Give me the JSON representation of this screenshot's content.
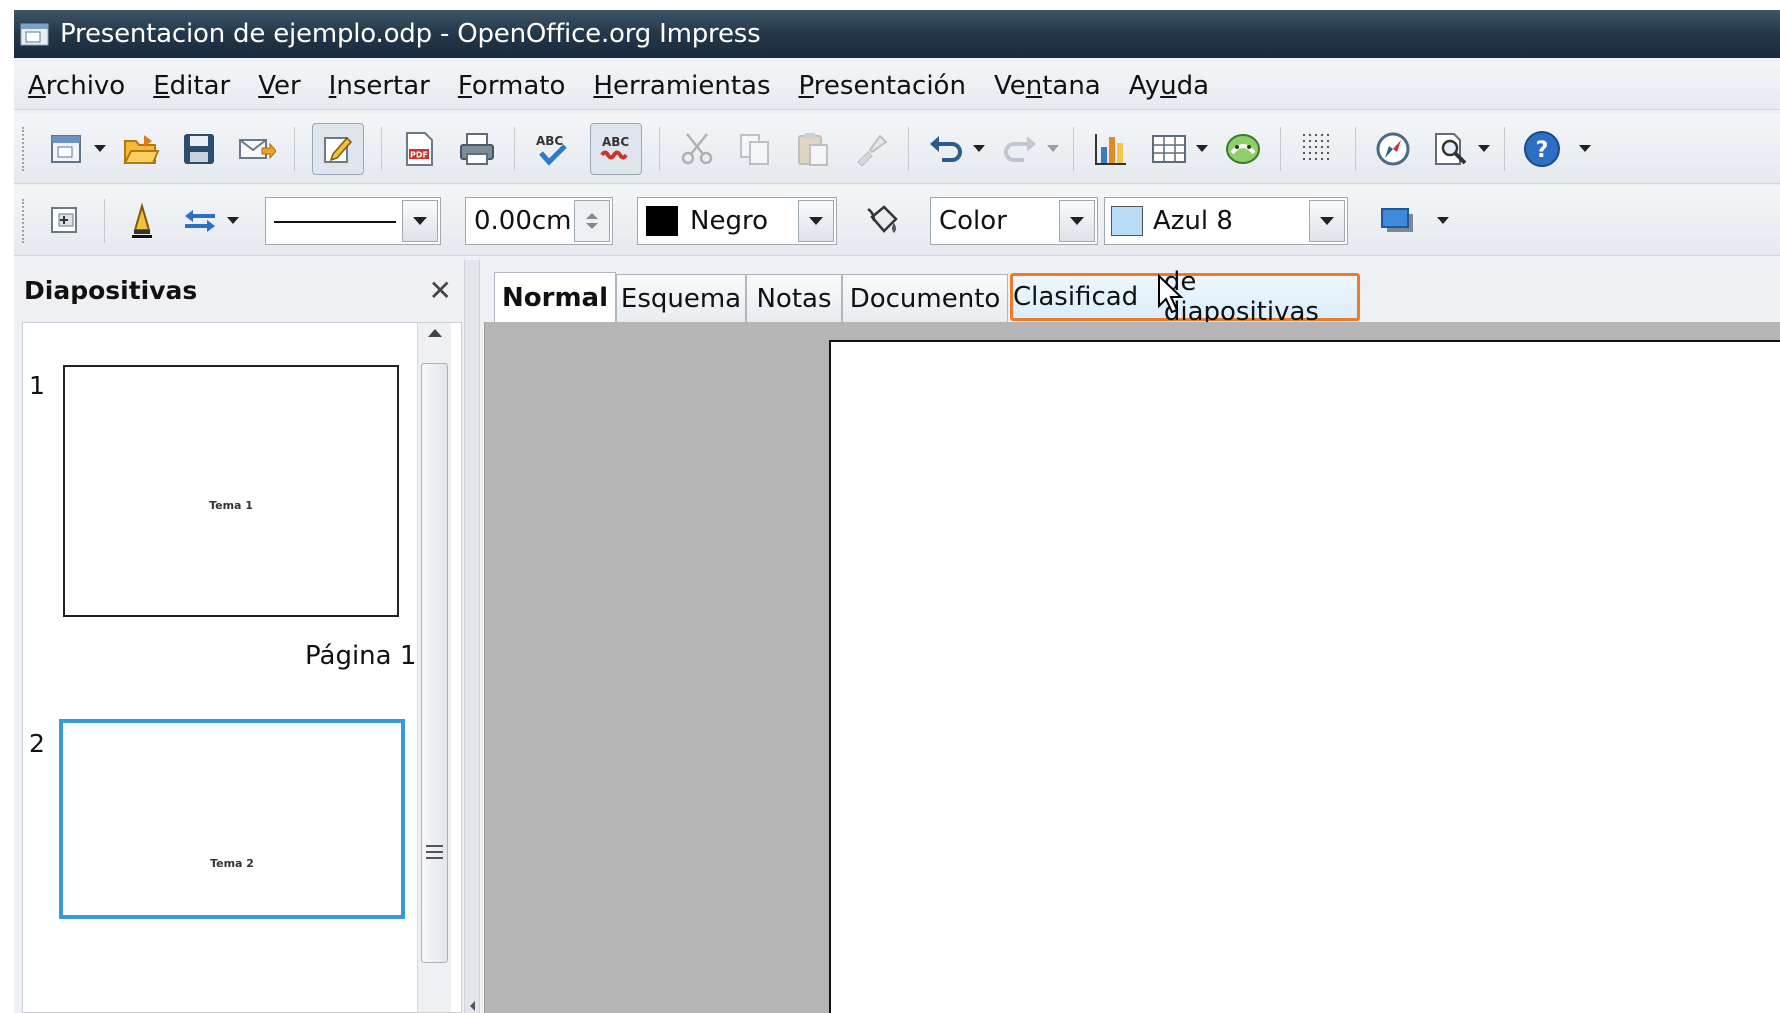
{
  "window": {
    "title": "Presentacion de ejemplo.odp - OpenOffice.org Impress"
  },
  "menu": [
    {
      "label": "Archivo",
      "ul": "A",
      "rest": "rchivo"
    },
    {
      "label": "Editar",
      "ul": "E",
      "rest": "ditar"
    },
    {
      "label": "Ver",
      "ul": "V",
      "rest": "er"
    },
    {
      "label": "Insertar",
      "ul": "I",
      "rest": "nsertar"
    },
    {
      "label": "Formato",
      "ul": "F",
      "rest": "ormato"
    },
    {
      "label": "Herramientas",
      "ul": "H",
      "rest": "erramientas"
    },
    {
      "label": "Presentación",
      "ul": "P",
      "rest": "resentación"
    },
    {
      "label": "Ventana",
      "pre": "Ve",
      "ul": "n",
      "rest": "tana"
    },
    {
      "label": "Ayuda",
      "pre": "Ay",
      "ul": "u",
      "rest": "da"
    }
  ],
  "toolbar2": {
    "line_width": "0.00cm",
    "line_color": "Negro",
    "line_color_hex": "#000000",
    "area_style": "Color",
    "area_color": "Azul 8",
    "area_color_hex": "#b8dcf5"
  },
  "sidebar": {
    "title": "Diapositivas",
    "slides": [
      {
        "number": "1",
        "thumb_text": "Tema 1",
        "page_label": "Página 1"
      },
      {
        "number": "2",
        "thumb_text": "Tema 2"
      }
    ]
  },
  "tabs": [
    "Normal",
    "Esquema",
    "Notas",
    "Documento",
    "Clasificador de diapositivas"
  ],
  "tab_cursor_text": {
    "before": "Clasificad",
    "after": "de diapositivas"
  },
  "colors": {
    "highlight": "#f07a2c",
    "selection": "#3a98dd"
  },
  "icons": [
    "new-icon",
    "open-icon",
    "save-icon",
    "email-icon",
    "edit-mode-icon",
    "pdf-icon",
    "print-icon",
    "spellcheck-icon",
    "autospellcheck-icon",
    "cut-icon",
    "copy-icon",
    "paste-icon",
    "format-paintbrush-icon",
    "undo-icon",
    "redo-icon",
    "chart-icon",
    "table-icon",
    "fontwork-icon",
    "grid-icon",
    "navigator-icon",
    "zoom-icon",
    "help-icon"
  ]
}
